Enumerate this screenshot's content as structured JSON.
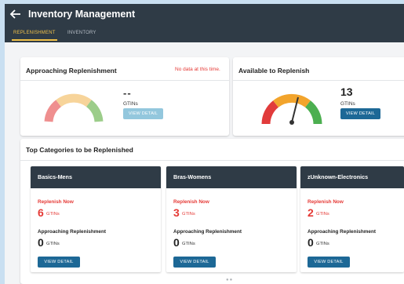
{
  "header": {
    "title": "Inventory Management"
  },
  "tabs": [
    {
      "label": "REPLENISHMENT"
    },
    {
      "label": "INVENTORY"
    }
  ],
  "approaching": {
    "title": "Approaching Replenishment",
    "no_data": "No data at this time.",
    "count": "--",
    "unit": "GTINs",
    "button": "VIEW DETAIL"
  },
  "available": {
    "title": "Available to Replenish",
    "count": "13",
    "unit": "GTINs",
    "button": "VIEW DETAIL"
  },
  "top_categories": {
    "title": "Top Categories to be Replenished",
    "cards": [
      {
        "name": "Basics-Mens",
        "now_label": "Replenish Now",
        "now_count": "6",
        "now_unit": "GTINs",
        "appr_label": "Approaching Replenishment",
        "appr_count": "0",
        "appr_unit": "GTINs",
        "button": "VIEW DETAIL"
      },
      {
        "name": "Bras-Womens",
        "now_label": "Replenish Now",
        "now_count": "3",
        "now_unit": "GTINs",
        "appr_label": "Approaching Replenishment",
        "appr_count": "0",
        "appr_unit": "GTINs",
        "button": "VIEW DETAIL"
      },
      {
        "name": "zUnknown-Electronics",
        "now_label": "Replenish Now",
        "now_count": "2",
        "now_unit": "GTINs",
        "appr_label": "Approaching Replenishment",
        "appr_count": "0",
        "appr_unit": "GTINs",
        "button": "VIEW DETAIL"
      }
    ]
  },
  "colors": {
    "header": "#2f3b46",
    "accent": "#f0c04a",
    "primary_button": "#1d6896",
    "alert": "#e53935"
  },
  "icons": {
    "back": "arrow-left-icon"
  }
}
